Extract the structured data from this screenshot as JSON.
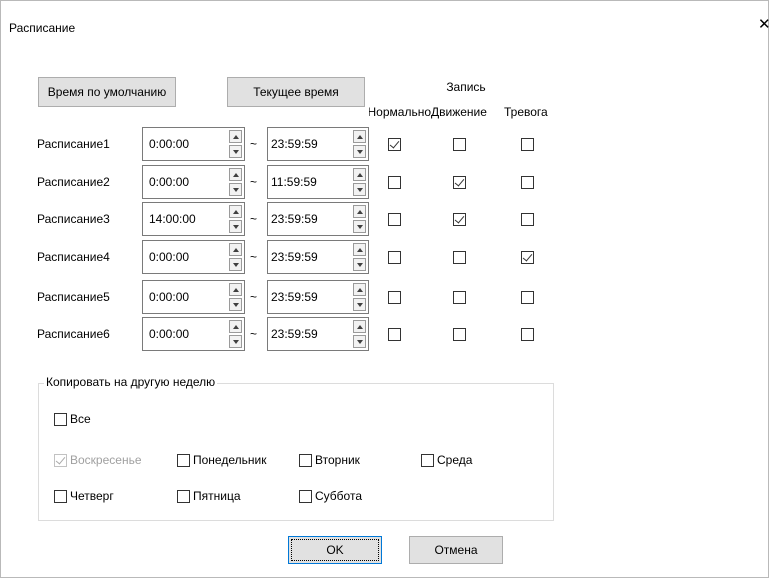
{
  "window": {
    "title": "Расписание",
    "close_glyph": "✕"
  },
  "buttons": {
    "default_time": "Время по умолчанию",
    "current_time": "Текущее время",
    "ok": "OK",
    "cancel": "Отмена"
  },
  "headers": {
    "record": "Запись",
    "normal": "Нормально",
    "motion": "Движение",
    "alarm": "Тревога"
  },
  "separator": "~",
  "schedules": [
    {
      "label": "Расписание1",
      "start": "0:00:00",
      "end": "23:59:59",
      "normal": true,
      "motion": false,
      "alarm": false
    },
    {
      "label": "Расписание2",
      "start": "0:00:00",
      "end": "11:59:59",
      "normal": false,
      "motion": true,
      "alarm": false
    },
    {
      "label": "Расписание3",
      "start": "14:00:00",
      "end": "23:59:59",
      "normal": false,
      "motion": true,
      "alarm": false
    },
    {
      "label": "Расписание4",
      "start": "0:00:00",
      "end": "23:59:59",
      "normal": false,
      "motion": false,
      "alarm": true
    },
    {
      "label": "Расписание5",
      "start": "0:00:00",
      "end": "23:59:59",
      "normal": false,
      "motion": false,
      "alarm": false
    },
    {
      "label": "Расписание6",
      "start": "0:00:00",
      "end": "23:59:59",
      "normal": false,
      "motion": false,
      "alarm": false
    }
  ],
  "copy": {
    "title": "Копировать на другую неделю",
    "all": {
      "label": "Все",
      "checked": false
    },
    "days": [
      {
        "label": "Воскресенье",
        "checked": true,
        "disabled": true
      },
      {
        "label": "Понедельник",
        "checked": false,
        "disabled": false
      },
      {
        "label": "Вторник",
        "checked": false,
        "disabled": false
      },
      {
        "label": "Среда",
        "checked": false,
        "disabled": false
      },
      {
        "label": "Четверг",
        "checked": false,
        "disabled": false
      },
      {
        "label": "Пятница",
        "checked": false,
        "disabled": false
      },
      {
        "label": "Суббота",
        "checked": false,
        "disabled": false
      }
    ]
  }
}
